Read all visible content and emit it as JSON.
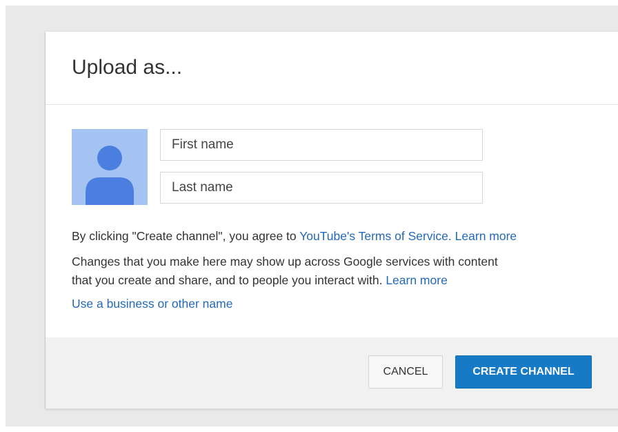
{
  "dialog": {
    "title": "Upload as..."
  },
  "form": {
    "first_name_placeholder": "First name",
    "last_name_placeholder": "Last name",
    "first_name_value": "",
    "last_name_value": ""
  },
  "avatar": {
    "icon": "person-icon",
    "bg_color": "#a4c3f3",
    "fg_color": "#4a7fe0"
  },
  "terms": {
    "prefix": "By clicking \"Create channel\", you agree to ",
    "tos_link": "YouTube's Terms of Service.",
    "learn_more_1": "Learn more"
  },
  "changes": {
    "line1": "Changes that you make here may show up across Google services with content",
    "line2": "that you create and share, and to people you interact with.",
    "learn_more_2": "Learn more"
  },
  "business": {
    "link": "Use a business or other name"
  },
  "buttons": {
    "cancel": "CANCEL",
    "create": "CREATE CHANNEL"
  },
  "colors": {
    "primary": "#167ac6",
    "link": "#2369b8",
    "backdrop": "#e9e9ea",
    "footer": "#f1f1f1"
  }
}
